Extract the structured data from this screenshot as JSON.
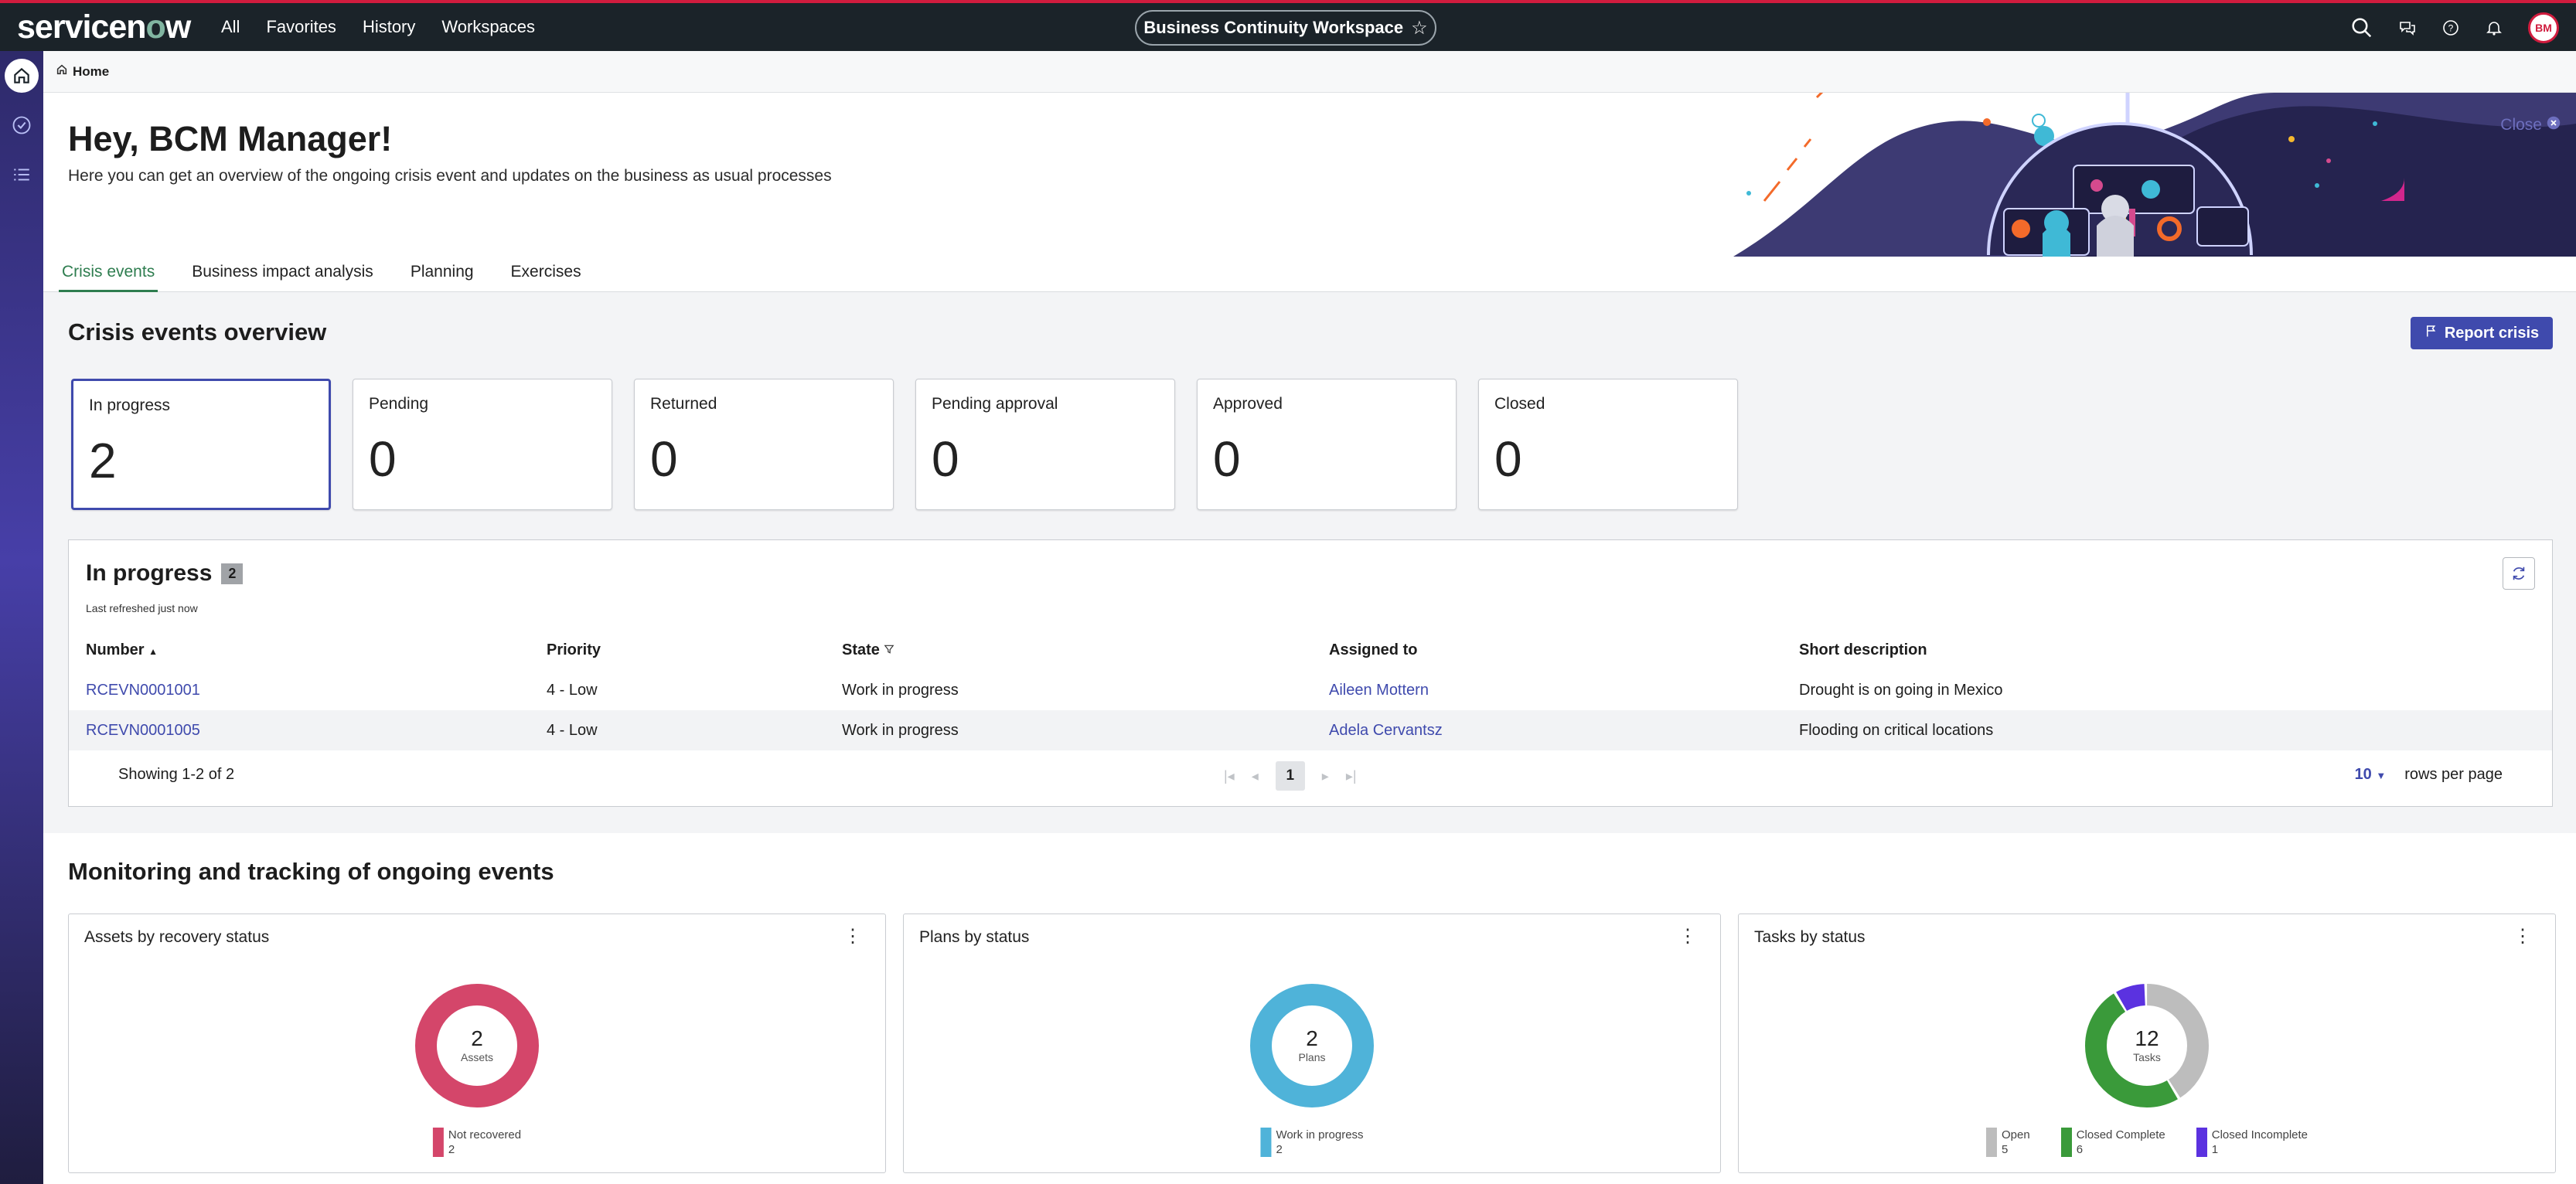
{
  "topnav": {
    "brand": "servicenow",
    "links": [
      "All",
      "Favorites",
      "History",
      "Workspaces"
    ],
    "workspace": "Business Continuity Workspace",
    "user_initials": "BM"
  },
  "breadcrumb": {
    "home": "Home"
  },
  "hero": {
    "greeting": "Hey, BCM Manager!",
    "subtitle": "Here you can get an overview of the ongoing crisis event and updates on the business as usual processes",
    "close": "Close"
  },
  "tabs": [
    "Crisis events",
    "Business impact analysis",
    "Planning",
    "Exercises"
  ],
  "overview": {
    "title": "Crisis events overview",
    "report_button": "Report crisis",
    "cards": [
      {
        "label": "In progress",
        "value": "2"
      },
      {
        "label": "Pending",
        "value": "0"
      },
      {
        "label": "Returned",
        "value": "0"
      },
      {
        "label": "Pending approval",
        "value": "0"
      },
      {
        "label": "Approved",
        "value": "0"
      },
      {
        "label": "Closed",
        "value": "0"
      }
    ]
  },
  "list": {
    "title": "In progress",
    "count": "2",
    "refreshed": "Last refreshed just now",
    "columns": [
      "Number",
      "Priority",
      "State",
      "Assigned to",
      "Short description"
    ],
    "rows": [
      {
        "number": "RCEVN0001001",
        "priority": "4 - Low",
        "state": "Work in progress",
        "assigned": "Aileen Mottern",
        "desc": "Drought is on going in Mexico"
      },
      {
        "number": "RCEVN0001005",
        "priority": "4 - Low",
        "state": "Work in progress",
        "assigned": "Adela Cervantsz",
        "desc": "Flooding on critical locations"
      }
    ],
    "showing": "Showing 1-2 of 2",
    "page": "1",
    "rows_per_page_value": "10",
    "rows_per_page_label": "rows per page"
  },
  "monitoring": {
    "title": "Monitoring and tracking of ongoing events",
    "charts": [
      {
        "title": "Assets by recovery status",
        "total": "2",
        "unit": "Assets",
        "segments": [
          {
            "label": "Not recovered",
            "value": 2,
            "color": "#d4466a"
          }
        ]
      },
      {
        "title": "Plans by status",
        "total": "2",
        "unit": "Plans",
        "segments": [
          {
            "label": "Work in progress",
            "value": 2,
            "color": "#4fb3d9"
          }
        ]
      },
      {
        "title": "Tasks by status",
        "total": "12",
        "unit": "Tasks",
        "segments": [
          {
            "label": "Open",
            "value": 5,
            "color": "#bdbdbd"
          },
          {
            "label": "Closed Complete",
            "value": 6,
            "color": "#3a9a3a"
          },
          {
            "label": "Closed Incomplete",
            "value": 1,
            "color": "#5b32e0"
          }
        ]
      }
    ]
  },
  "colors": {
    "accent": "#3f4aad",
    "topbar": "#1b2329",
    "active_tab": "#2e7d4f"
  }
}
